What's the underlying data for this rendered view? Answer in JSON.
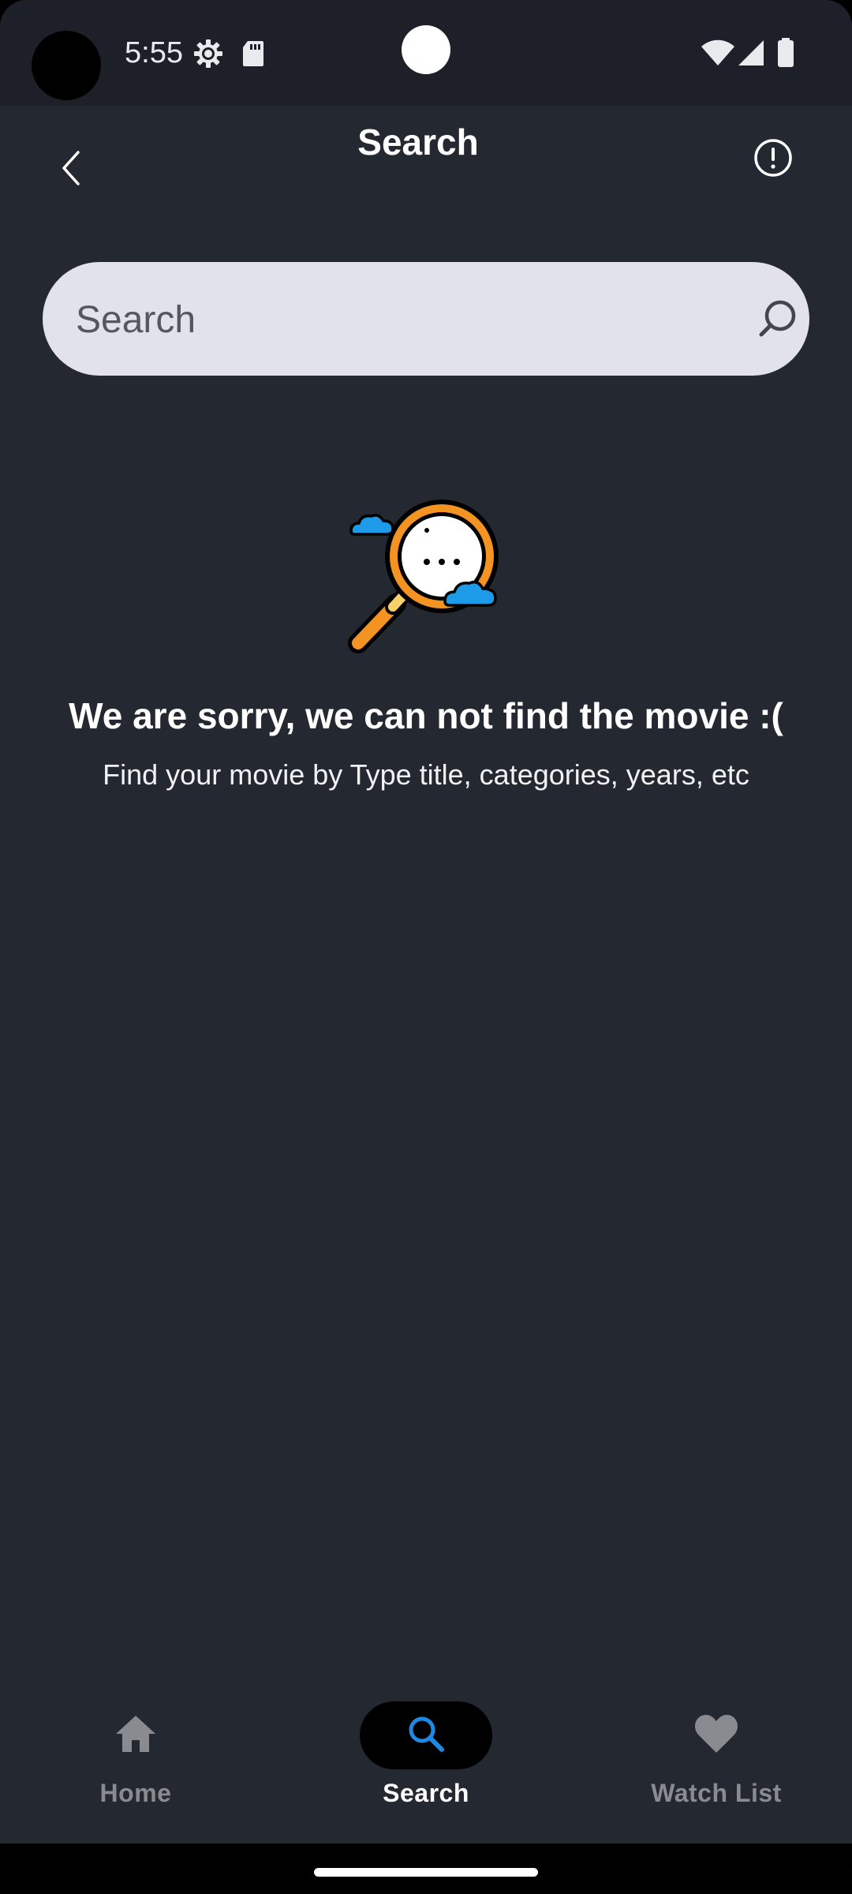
{
  "status_bar": {
    "time": "5:55",
    "icons": [
      "settings-gear-icon",
      "sd-card-icon",
      "wifi-icon",
      "cellular-signal-icon",
      "battery-icon"
    ]
  },
  "app_bar": {
    "title": "Search",
    "back_icon": "chevron-left-icon",
    "info_icon": "info-circle-icon"
  },
  "search": {
    "placeholder": "Search",
    "value": "",
    "icon": "search-icon"
  },
  "empty_state": {
    "illustration": "magnifying-glass-with-clouds-icon",
    "title": "We are sorry, we can not find the movie :(",
    "subtitle": "Find your movie by Type title, categories, years, etc"
  },
  "bottom_nav": {
    "items": [
      {
        "label": "Home",
        "icon": "home-icon",
        "active": false
      },
      {
        "label": "Search",
        "icon": "search-icon",
        "active": true
      },
      {
        "label": "Watch List",
        "icon": "heart-icon",
        "active": false
      }
    ]
  },
  "colors": {
    "background": "#232831",
    "status_bar": "#1d2028",
    "search_field": "#e2e2ec",
    "accent": "#1e88e5",
    "illustration_orange": "#f39321",
    "illustration_blue": "#1e9be8",
    "inactive_nav": "#8a8b90"
  }
}
